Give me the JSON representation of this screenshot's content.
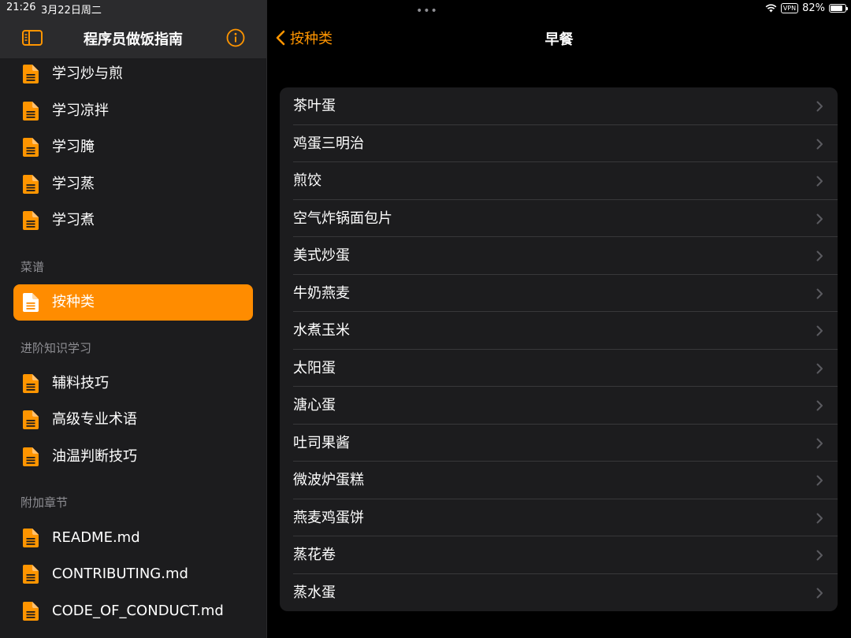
{
  "status": {
    "time": "21:26",
    "date": "3月22日周二",
    "vpn": "VPN",
    "battery": "82%"
  },
  "sidebar": {
    "title": "程序员做饭指南",
    "items_top": [
      {
        "label": "学习炒与煎",
        "icon": "document-icon"
      },
      {
        "label": "学习凉拌",
        "icon": "document-icon"
      },
      {
        "label": "学习腌",
        "icon": "document-icon"
      },
      {
        "label": "学习蒸",
        "icon": "document-icon"
      },
      {
        "label": "学习煮",
        "icon": "document-icon"
      }
    ],
    "section_recipes": "菜谱",
    "active_item": {
      "label": "按种类",
      "icon": "document-icon"
    },
    "section_advanced": "进阶知识学习",
    "items_advanced": [
      {
        "label": "辅料技巧"
      },
      {
        "label": "高级专业术语"
      },
      {
        "label": "油温判断技巧"
      }
    ],
    "section_appendix": "附加章节",
    "items_appendix": [
      {
        "label": "README.md"
      },
      {
        "label": "CONTRIBUTING.md"
      },
      {
        "label": "CODE_OF_CONDUCT.md"
      }
    ]
  },
  "detail": {
    "back_label": "按种类",
    "title": "早餐",
    "items": [
      "茶叶蛋",
      "鸡蛋三明治",
      "煎饺",
      "空气炸锅面包片",
      "美式炒蛋",
      "牛奶燕麦",
      "水煮玉米",
      "太阳蛋",
      "溏心蛋",
      "吐司果酱",
      "微波炉蛋糕",
      "燕麦鸡蛋饼",
      "蒸花卷",
      "蒸水蛋"
    ]
  },
  "colors": {
    "accent": "#ff9500",
    "active_bg": "#ff8c00",
    "sidebar_bg": "#1c1c1e",
    "list_bg": "#1c1c1e"
  }
}
